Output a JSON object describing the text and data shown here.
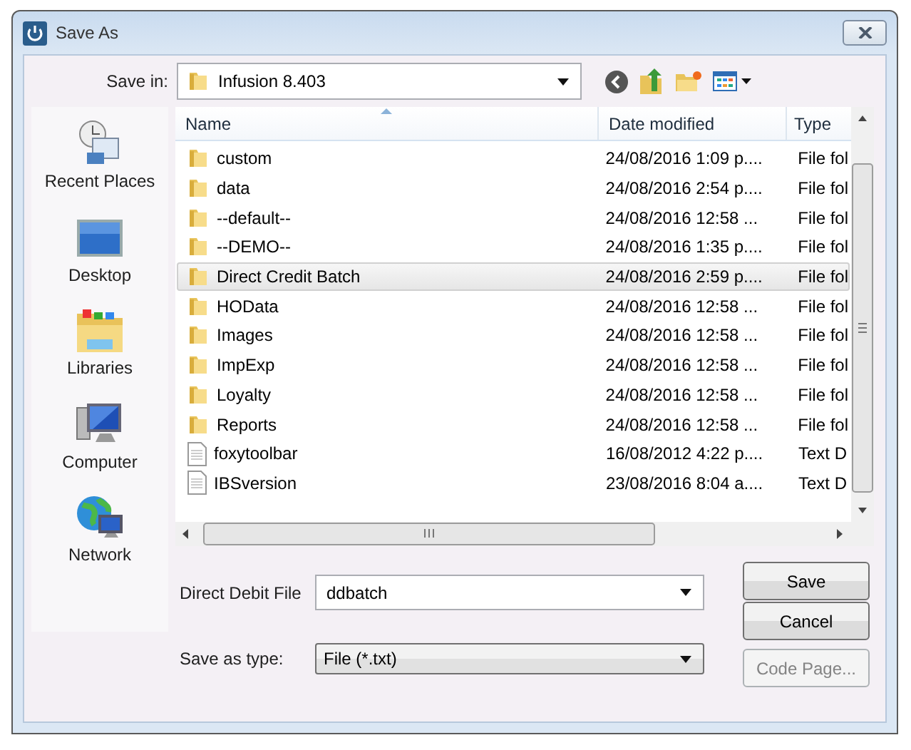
{
  "window": {
    "title": "Save As"
  },
  "save_in": {
    "label": "Save in:",
    "value": "Infusion 8.403"
  },
  "places": [
    {
      "kind": "recent",
      "label": "Recent Places"
    },
    {
      "kind": "desktop",
      "label": "Desktop"
    },
    {
      "kind": "libraries",
      "label": "Libraries"
    },
    {
      "kind": "computer",
      "label": "Computer"
    },
    {
      "kind": "network",
      "label": "Network"
    }
  ],
  "file_list": {
    "columns": [
      {
        "label": "Name",
        "sorted": true
      },
      {
        "label": "Date modified",
        "sorted": false
      },
      {
        "label": "Type",
        "sorted": false
      }
    ],
    "rows": [
      {
        "kind": "folder",
        "name": "custom",
        "date": "24/08/2016 1:09 p....",
        "type": "File fol",
        "selected": false
      },
      {
        "kind": "folder",
        "name": "data",
        "date": "24/08/2016 2:54 p....",
        "type": "File fol",
        "selected": false
      },
      {
        "kind": "folder",
        "name": "--default--",
        "date": "24/08/2016 12:58 ...",
        "type": "File fol",
        "selected": false
      },
      {
        "kind": "folder",
        "name": "--DEMO--",
        "date": "24/08/2016 1:35 p....",
        "type": "File fol",
        "selected": false
      },
      {
        "kind": "folder",
        "name": "Direct Credit Batch",
        "date": "24/08/2016 2:59 p....",
        "type": "File fol",
        "selected": true
      },
      {
        "kind": "folder",
        "name": "HOData",
        "date": "24/08/2016 12:58 ...",
        "type": "File fol",
        "selected": false
      },
      {
        "kind": "folder",
        "name": "Images",
        "date": "24/08/2016 12:58 ...",
        "type": "File fol",
        "selected": false
      },
      {
        "kind": "folder",
        "name": "ImpExp",
        "date": "24/08/2016 12:58 ...",
        "type": "File fol",
        "selected": false
      },
      {
        "kind": "folder",
        "name": "Loyalty",
        "date": "24/08/2016 12:58 ...",
        "type": "File fol",
        "selected": false
      },
      {
        "kind": "folder",
        "name": "Reports",
        "date": "24/08/2016 12:58 ...",
        "type": "File fol",
        "selected": false
      },
      {
        "kind": "file",
        "name": "foxytoolbar",
        "date": "16/08/2012 4:22 p....",
        "type": "Text D",
        "selected": false
      },
      {
        "kind": "file",
        "name": "IBSversion",
        "date": "23/08/2016 8:04 a....",
        "type": "Text D",
        "selected": false
      }
    ]
  },
  "file_name": {
    "label": "Direct Debit File",
    "value": "ddbatch"
  },
  "file_type": {
    "label": "Save as type:",
    "value": "File (*.txt)"
  },
  "buttons": [
    {
      "label": "Save",
      "disabled": false
    },
    {
      "label": "Cancel",
      "disabled": false
    },
    {
      "label": "Code Page...",
      "disabled": true
    }
  ]
}
